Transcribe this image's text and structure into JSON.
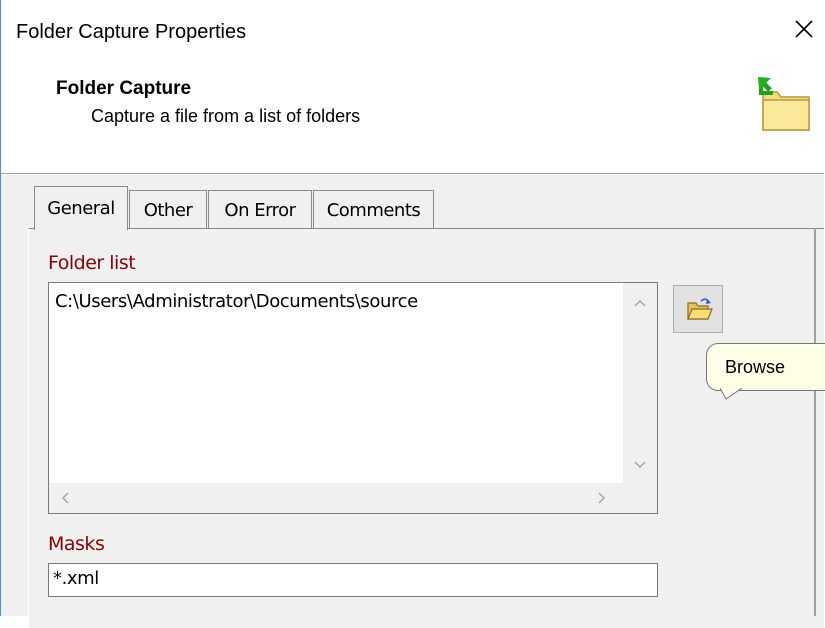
{
  "window": {
    "title": "Folder Capture Properties",
    "close_label": "Close"
  },
  "header": {
    "title": "Folder Capture",
    "subtitle": "Capture a file from a list of folders",
    "icon": "folder-add-icon"
  },
  "tabs": [
    {
      "label": "General",
      "active": true
    },
    {
      "label": "Other",
      "active": false
    },
    {
      "label": "On Error",
      "active": false
    },
    {
      "label": "Comments",
      "active": false
    }
  ],
  "general": {
    "folder_list_label": "Folder list",
    "folder_list_items": [
      "C:\\Users\\Administrator\\Documents\\source"
    ],
    "browse_icon": "open-folder-icon",
    "browse_tooltip": "Browse",
    "masks_label": "Masks",
    "masks_value": "*.xml"
  },
  "colors": {
    "label_red": "#8b0000",
    "tooltip_bg": "#fefde6",
    "window_border": "#4a90d9"
  }
}
